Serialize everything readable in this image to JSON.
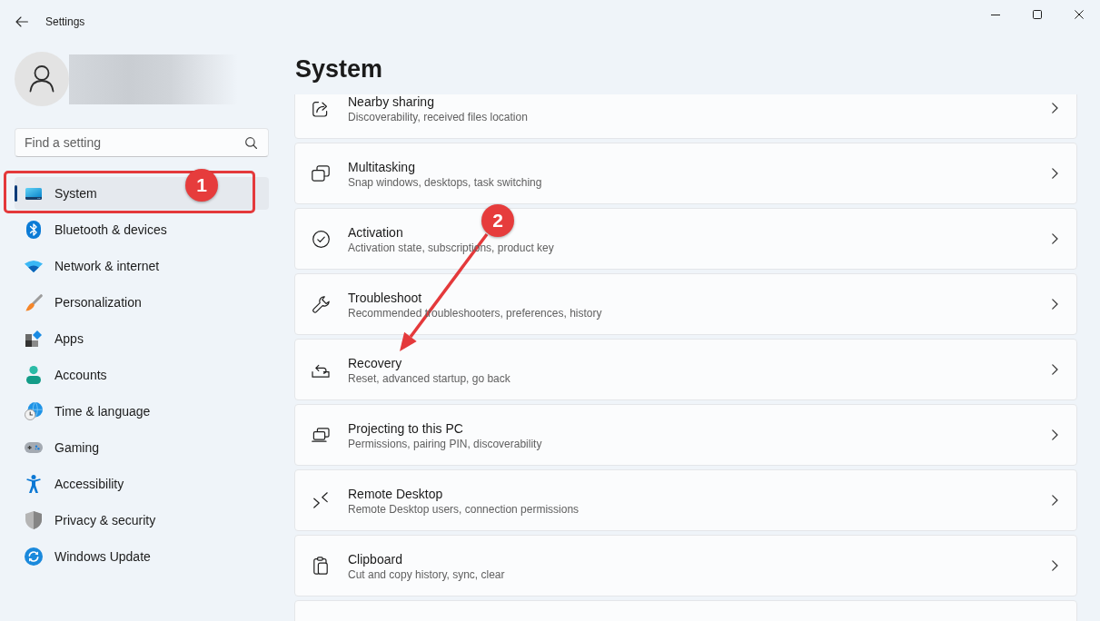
{
  "window": {
    "title": "Settings"
  },
  "sidebar": {
    "search": {
      "placeholder": "Find a setting"
    },
    "items": [
      {
        "label": "System",
        "selected": true
      },
      {
        "label": "Bluetooth & devices",
        "selected": false
      },
      {
        "label": "Network & internet",
        "selected": false
      },
      {
        "label": "Personalization",
        "selected": false
      },
      {
        "label": "Apps",
        "selected": false
      },
      {
        "label": "Accounts",
        "selected": false
      },
      {
        "label": "Time & language",
        "selected": false
      },
      {
        "label": "Gaming",
        "selected": false
      },
      {
        "label": "Accessibility",
        "selected": false
      },
      {
        "label": "Privacy & security",
        "selected": false
      },
      {
        "label": "Windows Update",
        "selected": false
      }
    ]
  },
  "page": {
    "title": "System",
    "cards": [
      {
        "kind": "full",
        "title": "Nearby sharing",
        "subtitle": "Discoverability, received files location"
      },
      {
        "kind": "full",
        "title": "Multitasking",
        "subtitle": "Snap windows, desktops, task switching"
      },
      {
        "kind": "full",
        "title": "Activation",
        "subtitle": "Activation state, subscriptions, product key"
      },
      {
        "kind": "full",
        "title": "Troubleshoot",
        "subtitle": "Recommended troubleshooters, preferences, history"
      },
      {
        "kind": "full",
        "title": "Recovery",
        "subtitle": "Reset, advanced startup, go back"
      },
      {
        "kind": "full",
        "title": "Projecting to this PC",
        "subtitle": "Permissions, pairing PIN, discoverability"
      },
      {
        "kind": "full",
        "title": "Remote Desktop",
        "subtitle": "Remote Desktop users, connection permissions"
      },
      {
        "kind": "full",
        "title": "Clipboard",
        "subtitle": "Cut and copy history, sync, clear"
      },
      {
        "kind": "partial"
      }
    ]
  },
  "annotations": [
    {
      "kind": "frame",
      "label": "1"
    },
    {
      "kind": "arrow",
      "label": "2"
    }
  ]
}
